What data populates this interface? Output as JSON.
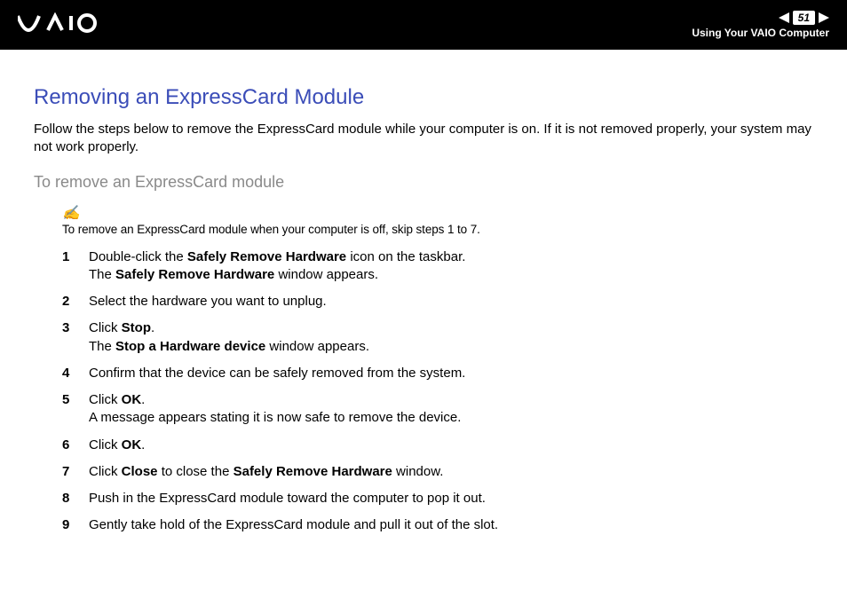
{
  "header": {
    "page_number": "51",
    "subtitle": "Using Your VAIO Computer"
  },
  "content": {
    "title": "Removing an ExpressCard Module",
    "intro": "Follow the steps below to remove the ExpressCard module while your computer is on. If it is not removed properly, your system may not work properly.",
    "subheading": "To remove an ExpressCard module",
    "note_icon": "✍",
    "note": "To remove an ExpressCard module when your computer is off, skip steps 1 to 7.",
    "steps": [
      {
        "n": "1",
        "html": "Double-click the <b>Safely Remove Hardware</b> icon on the taskbar.<br>The <b>Safely Remove Hardware</b> window appears."
      },
      {
        "n": "2",
        "html": "Select the hardware you want to unplug."
      },
      {
        "n": "3",
        "html": "Click <b>Stop</b>.<br>The <b>Stop a Hardware device</b> window appears."
      },
      {
        "n": "4",
        "html": "Confirm that the device can be safely removed from the system."
      },
      {
        "n": "5",
        "html": "Click <b>OK</b>.<br>A message appears stating it is now safe to remove the device."
      },
      {
        "n": "6",
        "html": "Click <b>OK</b>."
      },
      {
        "n": "7",
        "html": "Click <b>Close</b> to close the <b>Safely Remove Hardware</b> window."
      },
      {
        "n": "8",
        "html": "Push in the ExpressCard module toward the computer to pop it out."
      },
      {
        "n": "9",
        "html": "Gently take hold of the ExpressCard module and pull it out of the slot."
      }
    ]
  }
}
